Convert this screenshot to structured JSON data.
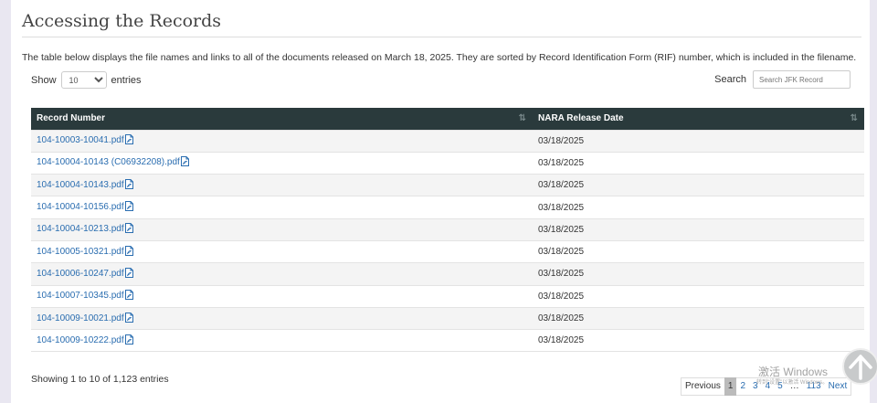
{
  "page": {
    "title": "Accessing the Records",
    "intro": "The table below displays the file names and links to all of the documents released on March 18, 2025.  They are sorted by Record Identification Form (RIF) number, which is included in the filename."
  },
  "length": {
    "prefix": "Show",
    "value": "10",
    "suffix": "entries"
  },
  "search": {
    "label": "Search",
    "placeholder": "Search JFK Record"
  },
  "table": {
    "headers": [
      "Record Number",
      "NARA Release Date"
    ],
    "rows": [
      {
        "record": "104-10003-10041.pdf",
        "date": "03/18/2025"
      },
      {
        "record": "104-10004-10143 (C06932208).pdf",
        "date": "03/18/2025"
      },
      {
        "record": "104-10004-10143.pdf",
        "date": "03/18/2025"
      },
      {
        "record": "104-10004-10156.pdf",
        "date": "03/18/2025"
      },
      {
        "record": "104-10004-10213.pdf",
        "date": "03/18/2025"
      },
      {
        "record": "104-10005-10321.pdf",
        "date": "03/18/2025"
      },
      {
        "record": "104-10006-10247.pdf",
        "date": "03/18/2025"
      },
      {
        "record": "104-10007-10345.pdf",
        "date": "03/18/2025"
      },
      {
        "record": "104-10009-10021.pdf",
        "date": "03/18/2025"
      },
      {
        "record": "104-10009-10222.pdf",
        "date": "03/18/2025"
      }
    ]
  },
  "info": "Showing 1 to 10 of 1,123 entries",
  "pagination": {
    "previous": "Previous",
    "pages": [
      "1",
      "2",
      "3",
      "4",
      "5"
    ],
    "ellipsis": "…",
    "last": "113",
    "next": "Next"
  },
  "watermark": {
    "main": "激活 Windows",
    "sub": "转到\"设置\"以激活 Windows。"
  },
  "colors": {
    "header_bg": "#2a3a3c",
    "link": "#2a6db0",
    "stripe": "#f4f4f4"
  },
  "icons": {
    "pdf": "pdf-file-icon",
    "sort": "sort-icon",
    "scroll_top": "arrow-up-icon"
  }
}
